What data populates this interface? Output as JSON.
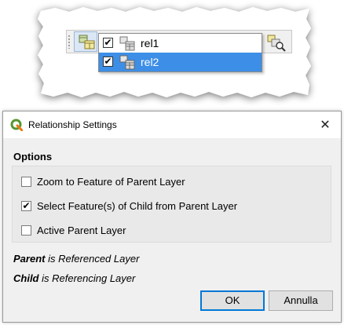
{
  "callout": {
    "dropdown": {
      "items": [
        {
          "label": "rel1",
          "checked": true,
          "highlighted": false
        },
        {
          "label": "rel2",
          "checked": true,
          "highlighted": true
        }
      ]
    },
    "icons": [
      "relation-tool-icon",
      "relation-layer-icon",
      "zoom-to-feature-icon"
    ]
  },
  "dialog": {
    "title": "Relationship Settings",
    "close_glyph": "✕",
    "options_heading": "Options",
    "options": [
      {
        "label": "Zoom to Feature of Parent Layer",
        "checked": false
      },
      {
        "label": "Select Feature(s) of Child from Parent Layer",
        "checked": true
      },
      {
        "label": "Active Parent Layer",
        "checked": false
      }
    ],
    "legend": [
      {
        "term": "Parent",
        "text": " is Referenced Layer"
      },
      {
        "term": "Child",
        "text": " is Referencing Layer"
      }
    ],
    "buttons": {
      "ok": "OK",
      "cancel": "Annulla"
    }
  },
  "colors": {
    "highlight": "#3d8ee6",
    "qgis_green": "#589632",
    "qgis_yellow": "#ee7913",
    "ok_border": "#0078d7"
  },
  "check_glyph": "✔"
}
